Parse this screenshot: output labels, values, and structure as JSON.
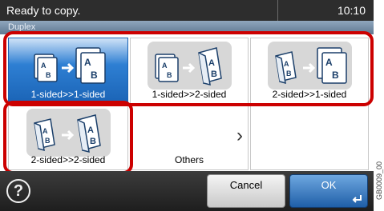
{
  "status": {
    "message": "Ready to copy.",
    "time": "10:10"
  },
  "screen_title": "Duplex",
  "options": [
    {
      "label": "1-sided>>1-sided",
      "selected": true,
      "icon": "one-to-one-sided-icon"
    },
    {
      "label": "1-sided>>2-sided",
      "selected": false,
      "icon": "one-to-two-sided-icon"
    },
    {
      "label": "2-sided>>1-sided",
      "selected": false,
      "icon": "two-to-one-sided-icon"
    },
    {
      "label": "2-sided>>2-sided",
      "selected": false,
      "icon": "two-to-two-sided-icon"
    }
  ],
  "others": {
    "label": "Others",
    "icon": "chevron-right-icon",
    "glyph": "›"
  },
  "footer": {
    "help_glyph": "?",
    "cancel_label": "Cancel",
    "ok_label": "OK",
    "ok_icon": "enter-icon"
  },
  "figure_code": "GB0009_00",
  "colors": {
    "selected_blue": "#1a63b5",
    "highlight_red": "#cc0000",
    "status_bar": "#2d2d2d"
  }
}
